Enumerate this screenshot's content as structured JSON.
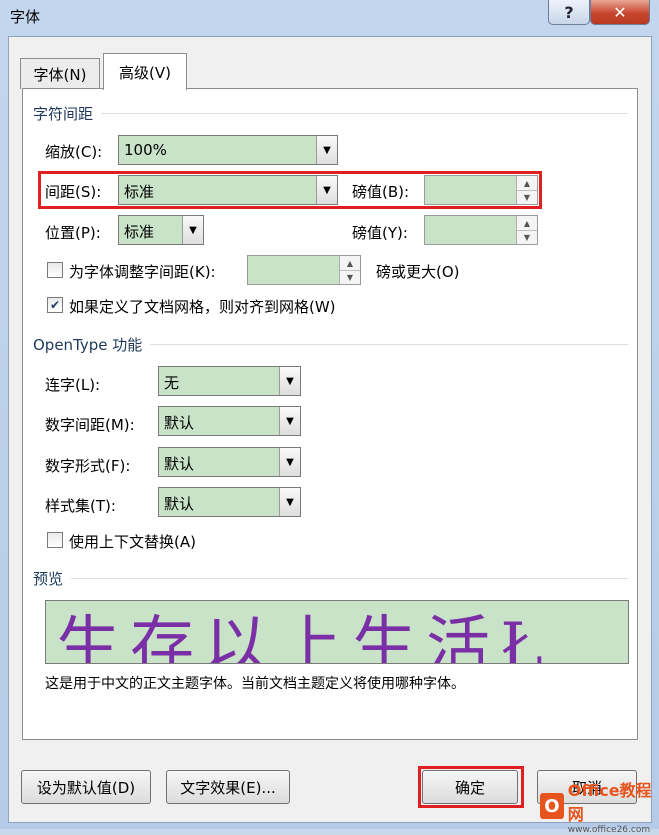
{
  "window": {
    "title": "字体",
    "help": "?",
    "close": "✕"
  },
  "tabs": [
    {
      "label": "字体(N)"
    },
    {
      "label": "高级(V)"
    }
  ],
  "char_spacing": {
    "group": "字符间距",
    "scale_label": "缩放(C):",
    "scale_value": "100%",
    "spacing_label": "间距(S):",
    "spacing_value": "标准",
    "spacing_pt_label": "磅值(B):",
    "spacing_pt_value": "",
    "position_label": "位置(P):",
    "position_value": "标准",
    "position_pt_label": "磅值(Y):",
    "position_pt_value": "",
    "kerning_label": "为字体调整字间距(K):",
    "kerning_value": "",
    "kerning_suffix": "磅或更大(O)",
    "kerning_checked": false,
    "grid_label": "如果定义了文档网格，则对齐到网格(W)",
    "grid_checked": true
  },
  "opentype": {
    "group": "OpenType 功能",
    "ligatures_label": "连字(L):",
    "ligatures_value": "无",
    "num_spacing_label": "数字间距(M):",
    "num_spacing_value": "默认",
    "num_forms_label": "数字形式(F):",
    "num_forms_value": "默认",
    "stylistic_label": "样式集(T):",
    "stylistic_value": "默认",
    "contextual_label": "使用上下文替换(A)",
    "contextual_checked": false
  },
  "preview": {
    "group": "预览",
    "sample": "生存以上生活Ł",
    "description": "这是用于中文的正文主题字体。当前文档主题定义将使用哪种字体。"
  },
  "buttons": {
    "set_default": "设为默认值(D)",
    "text_effects": "文字效果(E)...",
    "ok": "确定",
    "cancel": "取消"
  },
  "watermark": {
    "brand": "Office教程网",
    "url": "www.office26.com"
  }
}
